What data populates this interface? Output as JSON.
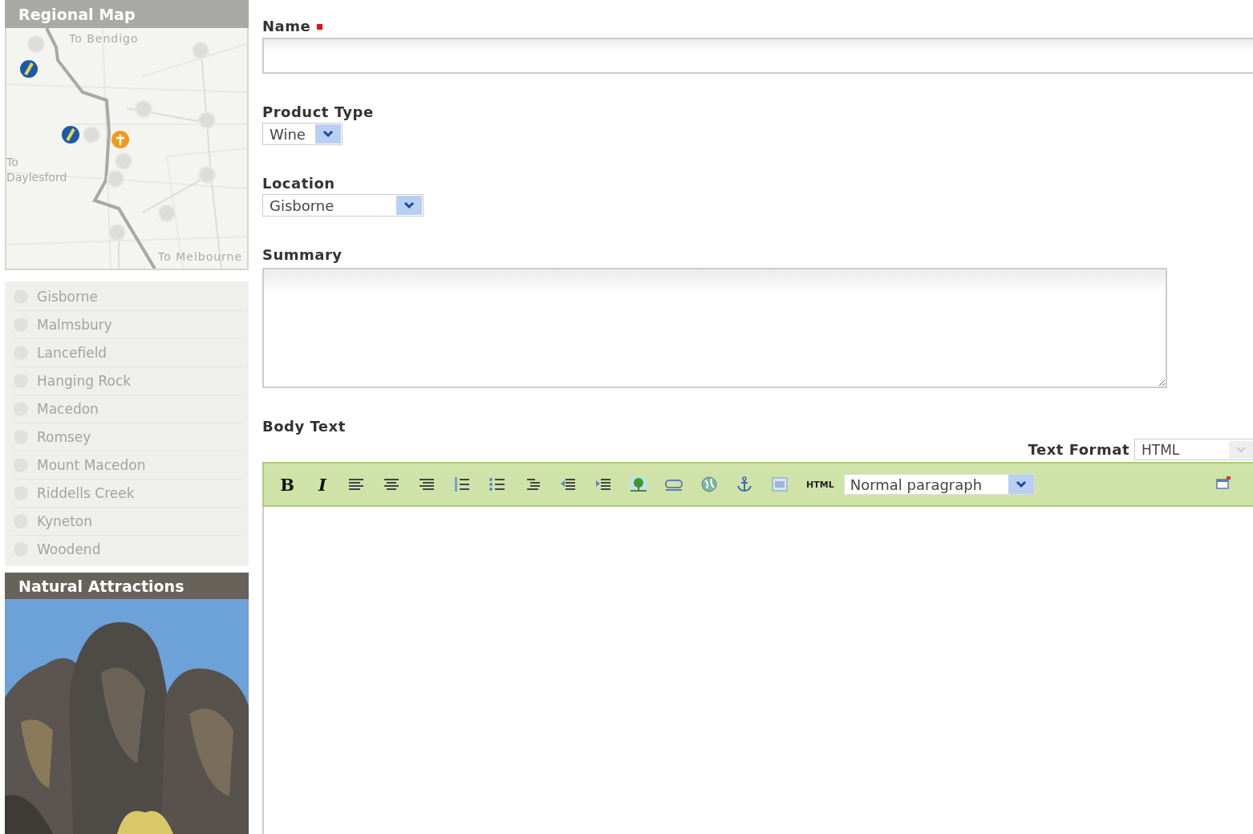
{
  "sidebar": {
    "map_panel": {
      "title": "Regional Map",
      "labels": [
        "To Bendigo",
        "To Daylesford",
        "To Melbourne"
      ]
    },
    "locations": [
      "Gisborne",
      "Malmsbury",
      "Lancefield",
      "Hanging Rock",
      "Macedon",
      "Romsey",
      "Mount Macedon",
      "Riddells Creek",
      "Kyneton",
      "Woodend"
    ],
    "attractions_panel": {
      "title": "Natural Attractions"
    }
  },
  "form": {
    "fields": [
      {
        "kind": "text",
        "label": "Name",
        "required": true
      },
      {
        "kind": "select",
        "label": "Product Type",
        "value": "Wine",
        "required": false
      },
      {
        "kind": "select",
        "label": "Location",
        "value": "Gisborne",
        "required": false
      },
      {
        "kind": "textarea",
        "label": "Summary",
        "required": false
      }
    ],
    "body_text": {
      "label": "Body Text",
      "text_format": {
        "label": "Text Format",
        "value": "HTML"
      },
      "toolbar": {
        "bold": "B",
        "italic": "I",
        "html": "HTML",
        "paragraph_style": "Normal paragraph"
      }
    }
  }
}
